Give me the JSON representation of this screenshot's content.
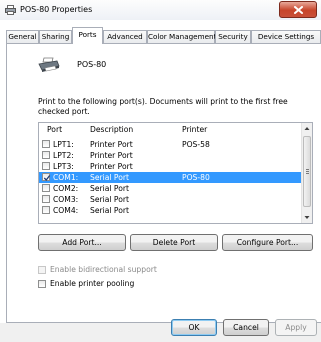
{
  "window": {
    "title": "POS-80 Properties",
    "close_glyph": "x"
  },
  "tabs": [
    {
      "label": "General"
    },
    {
      "label": "Sharing"
    },
    {
      "label": "Ports"
    },
    {
      "label": "Advanced"
    },
    {
      "label": "Color Management"
    },
    {
      "label": "Security"
    },
    {
      "label": "Device Settings"
    }
  ],
  "active_tab": "Ports",
  "printer": {
    "name": "POS-80",
    "icon": "printer-icon"
  },
  "description": "Print to the following port(s). Documents will print to the first free checked port.",
  "ports_table": {
    "columns": [
      "Port",
      "Description",
      "Printer"
    ],
    "rows": [
      {
        "port": "LPT1:",
        "description": "Printer Port",
        "printer": "POS-58",
        "checked": false,
        "selected": false
      },
      {
        "port": "LPT2:",
        "description": "Printer Port",
        "printer": "",
        "checked": false,
        "selected": false
      },
      {
        "port": "LPT3:",
        "description": "Printer Port",
        "printer": "",
        "checked": false,
        "selected": false
      },
      {
        "port": "COM1:",
        "description": "Serial Port",
        "printer": "POS-80",
        "checked": true,
        "selected": true
      },
      {
        "port": "COM2:",
        "description": "Serial Port",
        "printer": "",
        "checked": false,
        "selected": false
      },
      {
        "port": "COM3:",
        "description": "Serial Port",
        "printer": "",
        "checked": false,
        "selected": false
      },
      {
        "port": "COM4:",
        "description": "Serial Port",
        "printer": "",
        "checked": false,
        "selected": false
      }
    ]
  },
  "port_buttons": {
    "add": "Add Port...",
    "delete": "Delete Port",
    "configure": "Configure Port..."
  },
  "options": {
    "bidirectional": {
      "label": "Enable bidirectional support",
      "checked": false,
      "enabled": false
    },
    "pooling": {
      "label": "Enable printer pooling",
      "checked": false,
      "enabled": true
    }
  },
  "dialog_buttons": {
    "ok": "OK",
    "cancel": "Cancel",
    "apply": "Apply"
  },
  "colors": {
    "selection": "#3399ff",
    "close_button": "#c7452b",
    "border": "#a9aeb8"
  }
}
